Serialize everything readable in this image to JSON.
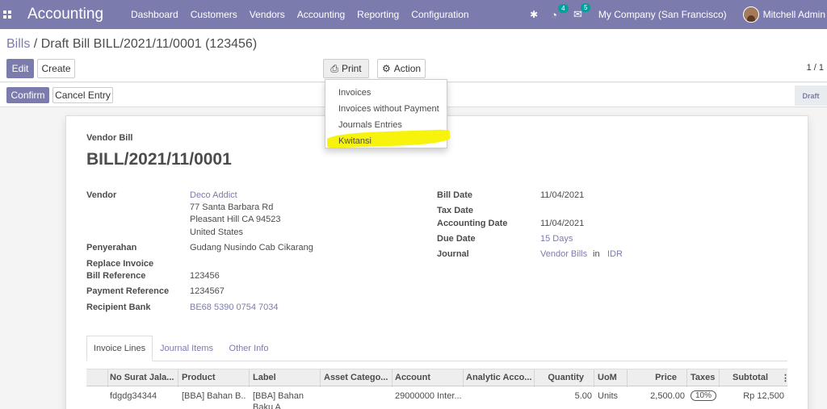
{
  "nav": {
    "brand": "Accounting",
    "menu": [
      "Dashboard",
      "Customers",
      "Vendors",
      "Accounting",
      "Reporting",
      "Configuration"
    ],
    "activity_count": "4",
    "message_count": "5",
    "company": "My Company (San Francisco)",
    "user": "Mitchell Admin"
  },
  "breadcrumb": {
    "parent": "Bills",
    "separator": "/",
    "current": "Draft Bill BILL/2021/11/0001 (123456)"
  },
  "buttons": {
    "edit": "Edit",
    "create": "Create",
    "print": "Print",
    "action": "Action",
    "confirm": "Confirm",
    "cancel_entry": "Cancel Entry"
  },
  "pager": "1 / 1",
  "status_stage": "Draft",
  "print_menu": [
    "Invoices",
    "Invoices without Payment",
    "Journals Entries",
    "Kwitansi"
  ],
  "form": {
    "type_label": "Vendor Bill",
    "number": "BILL/2021/11/0001",
    "vendor_label": "Vendor",
    "vendor_name": "Deco Addict",
    "vendor_address": [
      "77 Santa Barbara Rd",
      "Pleasant Hill CA 94523",
      "United States"
    ],
    "penyerahan_label": "Penyerahan",
    "penyerahan_value": "Gudang Nusindo Cab Cikarang",
    "replace_invoice_label": "Replace Invoice",
    "bill_reference_label": "Bill Reference",
    "bill_reference_value": "123456",
    "payment_reference_label": "Payment Reference",
    "payment_reference_value": "1234567",
    "recipient_bank_label": "Recipient Bank",
    "recipient_bank_value": "BE68 5390 0754 7034",
    "bill_date_label": "Bill Date",
    "bill_date_value": "11/04/2021",
    "tax_date_label": "Tax Date",
    "accounting_date_label": "Accounting Date",
    "accounting_date_value": "11/04/2021",
    "due_date_label": "Due Date",
    "due_date_value": "15 Days",
    "journal_label": "Journal",
    "journal_value": "Vendor Bills",
    "journal_in": "in",
    "journal_currency": "IDR"
  },
  "tabs": [
    "Invoice Lines",
    "Journal Items",
    "Other Info"
  ],
  "table": {
    "columns": [
      "No Surat Jala...",
      "Product",
      "Label",
      "Asset Catego...",
      "Account",
      "Analytic Acco...",
      "Quantity",
      "UoM",
      "Price",
      "Taxes",
      "Subtotal"
    ],
    "rows": [
      {
        "no_surat": "fdgdg34344",
        "product": "[BBA] Bahan B...",
        "label_line1": "[BBA] Bahan",
        "label_line2": "Baku A",
        "asset": "",
        "account": "29000000 Inter...",
        "analytic": "",
        "quantity": "5.00",
        "uom": "Units",
        "price": "2,500.00",
        "taxes": "10%",
        "subtotal": "Rp 12,500"
      }
    ]
  }
}
